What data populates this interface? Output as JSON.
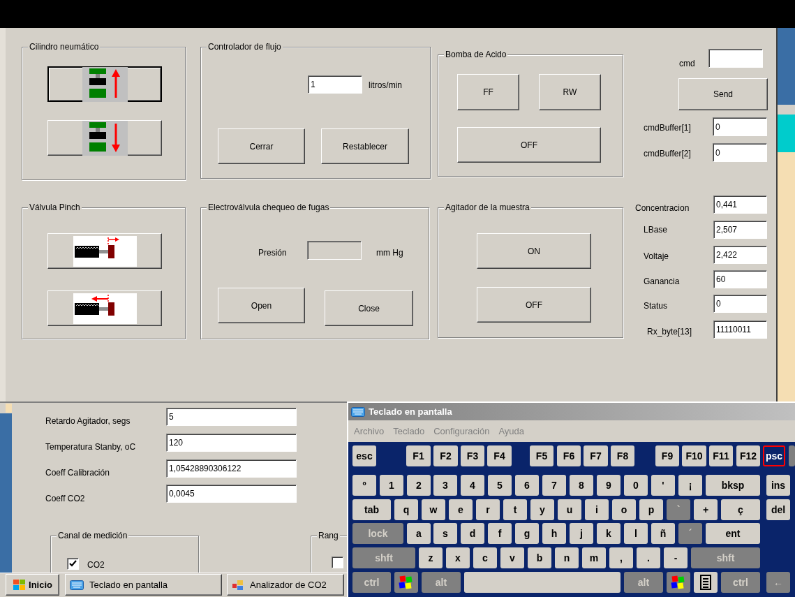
{
  "main_window": {
    "cylinder_group": {
      "title": "Cilindro neumático",
      "buttons": [
        {
          "kind": "up",
          "focused": true
        },
        {
          "kind": "down",
          "focused": false
        }
      ]
    },
    "flow_group": {
      "title": "Controlador de flujo",
      "value": "1",
      "unit": "litros/min",
      "buttons": [
        "Cerrar",
        "Restablecer"
      ]
    },
    "acid_pump_group": {
      "title": "Bomba de Acido",
      "buttons": [
        "FF",
        "RW",
        "OFF"
      ]
    },
    "command": {
      "label": "cmd",
      "button": "Send",
      "buffers": [
        {
          "label": "cmdBuffer[1]",
          "value": "0"
        },
        {
          "label": "cmdBuffer[2]",
          "value": "0"
        }
      ]
    },
    "pinch_valve_group": {
      "title": "Válvula Pinch",
      "buttons": [
        {
          "kind": "extend"
        },
        {
          "kind": "retract"
        }
      ]
    },
    "leak_check_group": {
      "title": "Electroválvula chequeo de fugas",
      "pressure_label": "Presión",
      "pressure_disabled": true,
      "pressure_unit": "mm Hg",
      "buttons": [
        "Open",
        "Close"
      ]
    },
    "stirrer_group": {
      "title": "Agitador de la muestra",
      "buttons": [
        "ON",
        "OFF"
      ]
    },
    "readings": [
      {
        "label": "Concentracion",
        "value": "0,441"
      },
      {
        "label": "LBase",
        "value": "2,507"
      },
      {
        "label": "Voltaje",
        "value": "2,422"
      },
      {
        "label": "Ganancia",
        "value": "60"
      },
      {
        "label": "Status",
        "value": "0"
      },
      {
        "label": "Rx_byte[13]",
        "value": "11110011"
      }
    ]
  },
  "settings_window": {
    "fields": [
      {
        "label": "Retardo Agitador, segs",
        "value": "5"
      },
      {
        "label": "Temperatura Stanby, oC",
        "value": "120"
      },
      {
        "label": "Coeff Calibración",
        "value": "1,05428890306122"
      },
      {
        "label": "Coeff CO2",
        "value": "0,0045"
      }
    ],
    "channel_group": {
      "title": "Canal de medición",
      "options": [
        {
          "label": "CO2",
          "checked": true
        }
      ]
    },
    "range_group": {
      "title": "Rang",
      "options": [
        {
          "checked": false
        }
      ]
    }
  },
  "keyboard_window": {
    "title": "Teclado en pantalla",
    "menu": [
      "Archivo",
      "Teclado",
      "Configuración",
      "Ayuda"
    ],
    "key_rows": [
      {
        "keys": [
          {
            "label": "esc",
            "kind": "key"
          },
          {
            "label": "F1",
            "kind": "key"
          },
          {
            "label": "F2",
            "kind": "key"
          },
          {
            "label": "F3",
            "kind": "key"
          },
          {
            "label": "F4",
            "kind": "key"
          },
          {
            "label": "F5",
            "kind": "key"
          },
          {
            "label": "F6",
            "kind": "key"
          },
          {
            "label": "F7",
            "kind": "key"
          },
          {
            "label": "F8",
            "kind": "key"
          },
          {
            "label": "F9",
            "kind": "key"
          },
          {
            "label": "F10",
            "kind": "key"
          },
          {
            "label": "F11",
            "kind": "key"
          },
          {
            "label": "F12",
            "kind": "key"
          },
          {
            "label": "psc",
            "kind": "active"
          },
          {
            "kind": "edge"
          }
        ]
      },
      {
        "keys": [
          {
            "label": "º",
            "kind": "key"
          },
          {
            "label": "1",
            "kind": "key"
          },
          {
            "label": "2",
            "kind": "key"
          },
          {
            "label": "3",
            "kind": "key"
          },
          {
            "label": "4",
            "kind": "key"
          },
          {
            "label": "5",
            "kind": "key"
          },
          {
            "label": "6",
            "kind": "key"
          },
          {
            "label": "7",
            "kind": "key"
          },
          {
            "label": "8",
            "kind": "key"
          },
          {
            "label": "9",
            "kind": "key"
          },
          {
            "label": "0",
            "kind": "key"
          },
          {
            "label": "'",
            "kind": "key"
          },
          {
            "label": "¡",
            "kind": "key"
          },
          {
            "label": "bksp",
            "kind": "key"
          },
          {
            "label": "ins",
            "kind": "key"
          }
        ]
      },
      {
        "keys": [
          {
            "label": "tab",
            "kind": "key"
          },
          {
            "label": "q",
            "kind": "key"
          },
          {
            "label": "w",
            "kind": "key"
          },
          {
            "label": "e",
            "kind": "key"
          },
          {
            "label": "r",
            "kind": "key"
          },
          {
            "label": "t",
            "kind": "key"
          },
          {
            "label": "y",
            "kind": "key"
          },
          {
            "label": "u",
            "kind": "key"
          },
          {
            "label": "i",
            "kind": "key"
          },
          {
            "label": "o",
            "kind": "key"
          },
          {
            "label": "p",
            "kind": "key"
          },
          {
            "label": "`",
            "kind": "dim"
          },
          {
            "label": "+",
            "kind": "key"
          },
          {
            "label": "ç",
            "kind": "key"
          },
          {
            "label": "del",
            "kind": "key"
          }
        ]
      },
      {
        "keys": [
          {
            "label": "lock",
            "kind": "dim"
          },
          {
            "label": "a",
            "kind": "key"
          },
          {
            "label": "s",
            "kind": "key"
          },
          {
            "label": "d",
            "kind": "key"
          },
          {
            "label": "f",
            "kind": "key"
          },
          {
            "label": "g",
            "kind": "key"
          },
          {
            "label": "h",
            "kind": "key"
          },
          {
            "label": "j",
            "kind": "key"
          },
          {
            "label": "k",
            "kind": "key"
          },
          {
            "label": "l",
            "kind": "key"
          },
          {
            "label": "ñ",
            "kind": "key"
          },
          {
            "label": "´",
            "kind": "dim"
          },
          {
            "label": "ent",
            "kind": "key"
          }
        ]
      },
      {
        "keys": [
          {
            "label": "shft",
            "kind": "dim"
          },
          {
            "label": "z",
            "kind": "key"
          },
          {
            "label": "x",
            "kind": "key"
          },
          {
            "label": "c",
            "kind": "key"
          },
          {
            "label": "v",
            "kind": "key"
          },
          {
            "label": "b",
            "kind": "key"
          },
          {
            "label": "n",
            "kind": "key"
          },
          {
            "label": "m",
            "kind": "key"
          },
          {
            "label": ",",
            "kind": "key"
          },
          {
            "label": ".",
            "kind": "key"
          },
          {
            "label": "-",
            "kind": "key"
          },
          {
            "label": "shft",
            "kind": "dim"
          }
        ]
      },
      {
        "keys": [
          {
            "label": "ctrl",
            "kind": "dim"
          },
          {
            "kind": "logo"
          },
          {
            "label": "alt",
            "kind": "dim"
          },
          {
            "kind": "space"
          },
          {
            "label": "alt",
            "kind": "dim"
          },
          {
            "kind": "logo"
          },
          {
            "kind": "menu"
          },
          {
            "label": "ctrl",
            "kind": "dim"
          },
          {
            "label": "←",
            "kind": "dim"
          }
        ]
      }
    ]
  },
  "taskbar": {
    "start": "Inicio",
    "tasks": [
      {
        "label": "Teclado en pantalla",
        "kind": "keyboard",
        "selected": false
      },
      {
        "label": "Analizador de CO2",
        "kind": "app",
        "selected": false
      }
    ]
  }
}
